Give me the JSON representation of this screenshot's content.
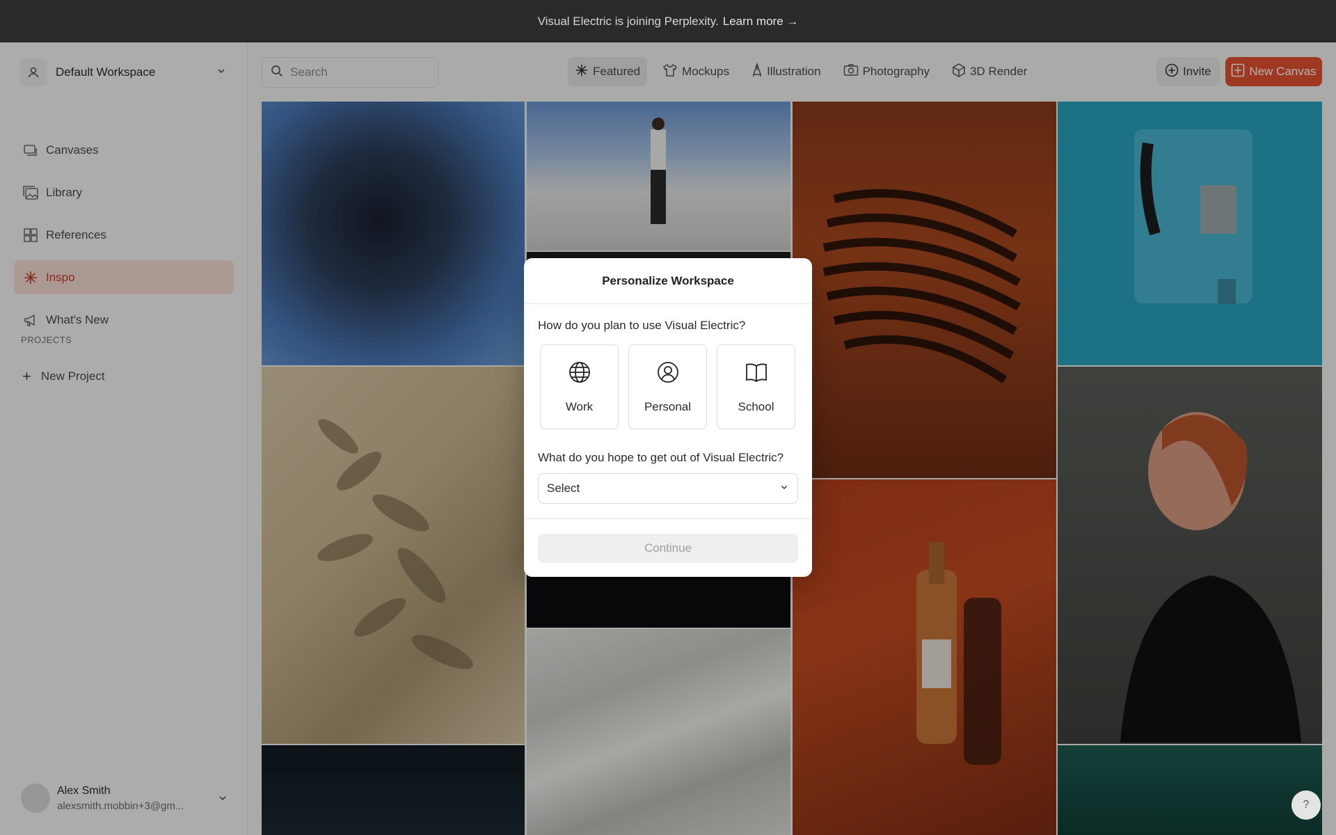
{
  "banner": {
    "text": "Visual Electric is joining Perplexity.",
    "link": "Learn more →"
  },
  "workspace": {
    "name": "Default Workspace"
  },
  "nav": {
    "items": [
      {
        "label": "Canvases",
        "icon": "canvases-icon"
      },
      {
        "label": "Library",
        "icon": "library-icon"
      },
      {
        "label": "References",
        "icon": "references-icon"
      },
      {
        "label": "Inspo",
        "icon": "sparkle-icon",
        "active": true
      },
      {
        "label": "What's New",
        "icon": "megaphone-icon"
      }
    ],
    "projects_label": "PROJECTS",
    "new_project": "New Project"
  },
  "user": {
    "name": "Alex Smith",
    "email": "alexsmith.mobbin+3@gm..."
  },
  "search": {
    "placeholder": "Search"
  },
  "categories": [
    {
      "label": "Featured",
      "icon": "sparkle-icon",
      "active": true
    },
    {
      "label": "Mockups",
      "icon": "shirt-icon"
    },
    {
      "label": "Illustration",
      "icon": "pen-nib-icon"
    },
    {
      "label": "Photography",
      "icon": "camera-icon"
    },
    {
      "label": "3D Render",
      "icon": "cube-icon"
    }
  ],
  "actions": {
    "invite": "Invite",
    "new_canvas": "New Canvas"
  },
  "modal": {
    "title": "Personalize Workspace",
    "question1": "How do you plan to use Visual Electric?",
    "options": [
      {
        "label": "Work",
        "icon": "globe-icon"
      },
      {
        "label": "Personal",
        "icon": "user-circle-icon"
      },
      {
        "label": "School",
        "icon": "book-icon"
      }
    ],
    "question2": "What do you hope to get out of Visual Electric?",
    "select_value": "Select",
    "continue": "Continue"
  },
  "help": "?",
  "colors": {
    "accent": "#e4512f",
    "active_bg": "#f8dcd5",
    "active_text": "#c2412a",
    "banner_bg": "#2a2a2a"
  }
}
